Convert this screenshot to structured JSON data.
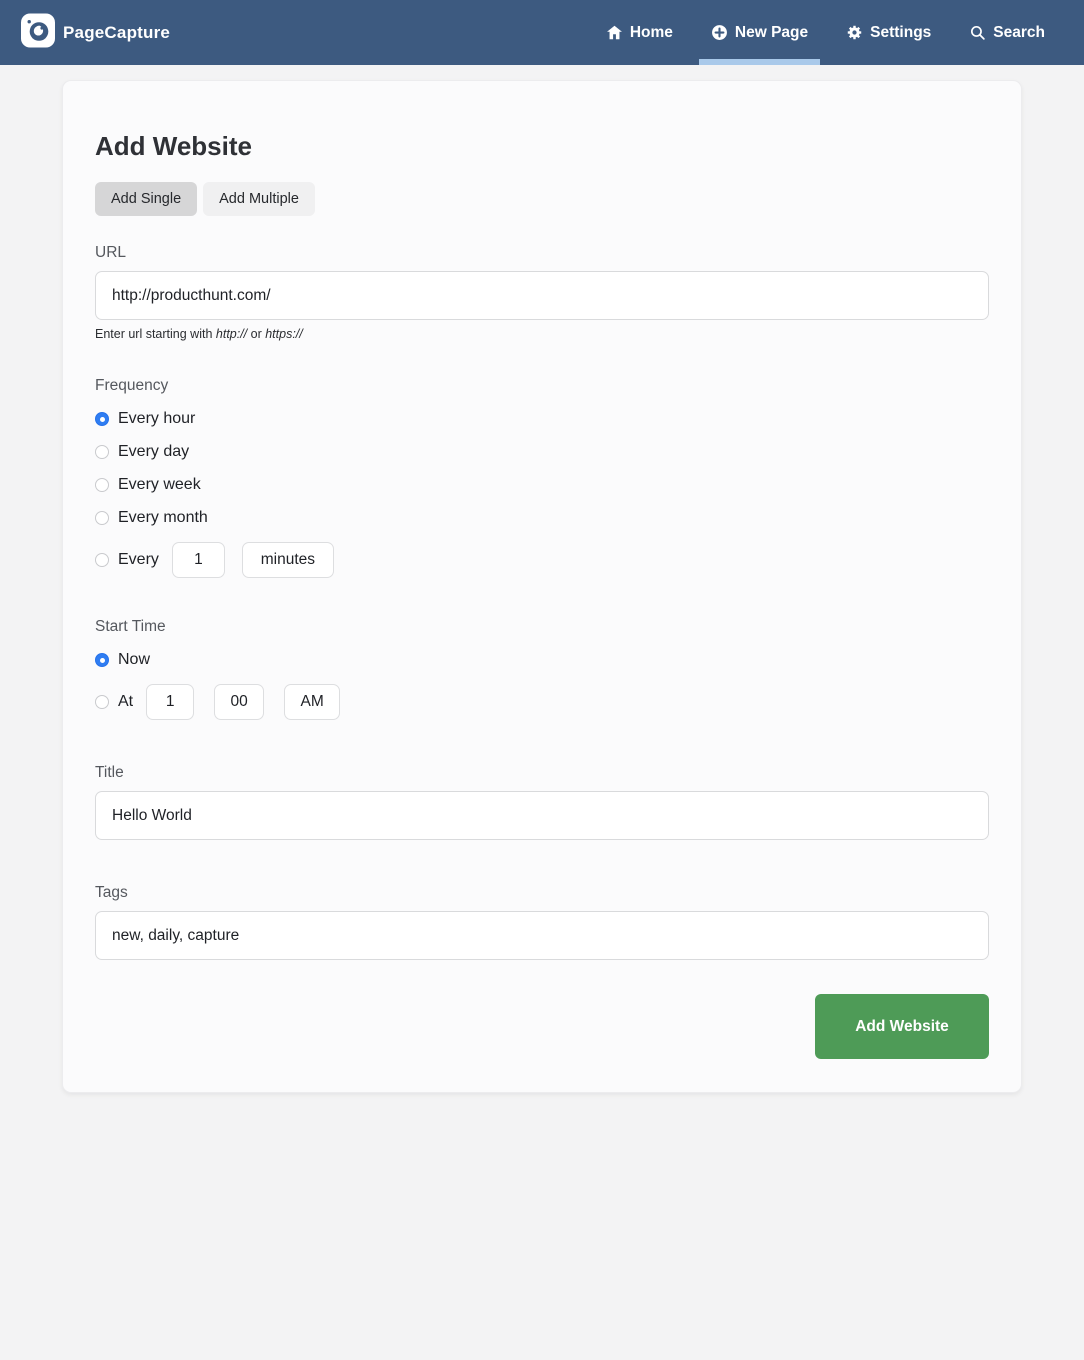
{
  "colors": {
    "navbar": "#3d5a80",
    "active_tab_underline": "#a9c9ea",
    "radio_selected": "#2f7df2",
    "submit_button": "#4e9b57"
  },
  "nav": {
    "brand": "PageCapture",
    "items": [
      {
        "label": "Home",
        "icon": "home-icon",
        "active": false
      },
      {
        "label": "New Page",
        "icon": "plus-circle-icon",
        "active": true
      },
      {
        "label": "Settings",
        "icon": "gear-icon",
        "active": false
      },
      {
        "label": "Search",
        "icon": "search-icon",
        "active": false
      }
    ]
  },
  "form": {
    "title": "Add Website",
    "tabs": {
      "single": "Add Single",
      "multiple": "Add Multiple",
      "active": "Add Single"
    },
    "url": {
      "label": "URL",
      "value": "http://producthunt.com/",
      "hint_prefix": "Enter url starting with ",
      "hint_http": "http://",
      "hint_or": " or ",
      "hint_https": "https://"
    },
    "frequency": {
      "label": "Frequency",
      "option_hour": "Every hour",
      "option_day": "Every day",
      "option_week": "Every week",
      "option_month": "Every month",
      "custom_prefix": "Every",
      "custom_value": "1",
      "custom_unit": "minutes",
      "selected": "Every hour"
    },
    "start_time": {
      "label": "Start Time",
      "option_now": "Now",
      "option_at": "At",
      "hour": "1",
      "minute": "00",
      "meridiem": "AM",
      "selected": "Now"
    },
    "title_field": {
      "label": "Title",
      "value": "Hello World"
    },
    "tags_field": {
      "label": "Tags",
      "value": "new, daily, capture"
    },
    "submit_label": "Add Website"
  }
}
